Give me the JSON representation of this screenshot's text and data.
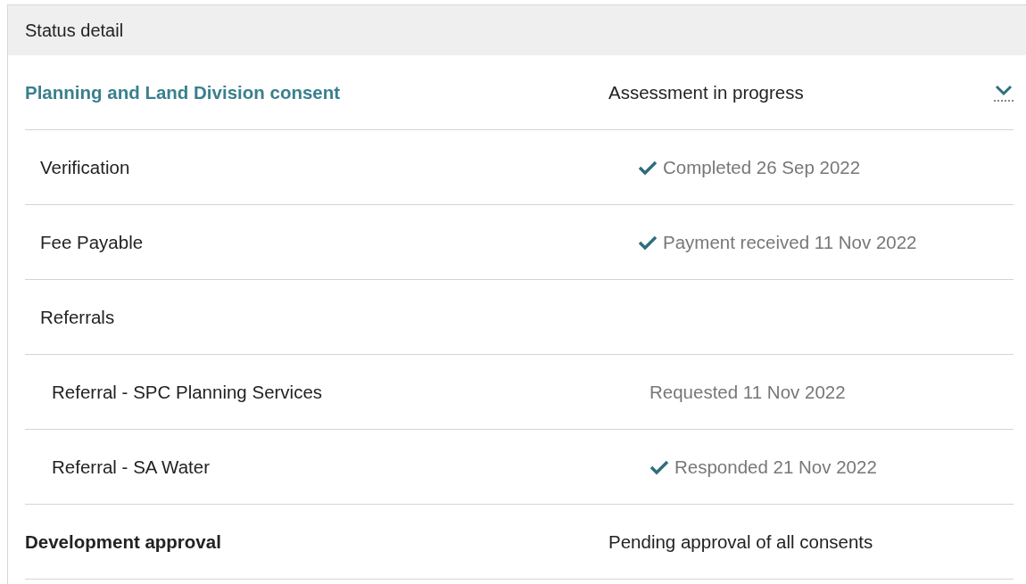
{
  "panel": {
    "title": "Status detail"
  },
  "items": [
    {
      "label": "Planning and Land Division consent",
      "kind": "consent",
      "status": "Assessment in progress",
      "expanded": true,
      "children": [
        {
          "label": "Verification",
          "status": "Completed 26 Sep 2022",
          "done": true
        },
        {
          "label": "Fee Payable",
          "status": "Payment received 11 Nov 2022",
          "done": true
        },
        {
          "label": "Referrals",
          "children": [
            {
              "label": "Referral - SPC Planning Services",
              "status": "Requested 11 Nov 2022",
              "done": false
            },
            {
              "label": "Referral - SA Water",
              "status": "Responded 21 Nov 2022",
              "done": true
            }
          ]
        }
      ]
    },
    {
      "label": "Development approval",
      "kind": "approval",
      "status": "Pending approval of all consents"
    }
  ]
}
